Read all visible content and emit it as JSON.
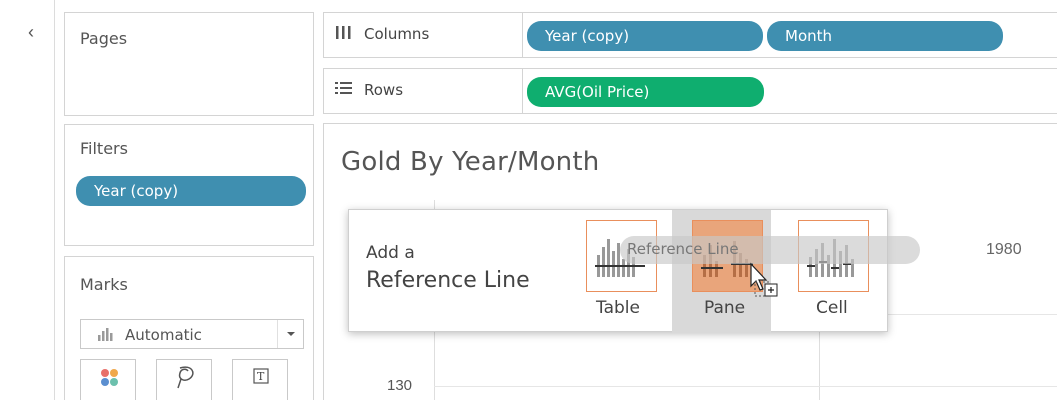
{
  "sidebar": {
    "collapse_glyph": "‹",
    "pages": {
      "title": "Pages"
    },
    "filters": {
      "title": "Filters",
      "pills": [
        {
          "label": "Year (copy)"
        }
      ]
    },
    "marks": {
      "title": "Marks",
      "mark_type": "Automatic",
      "buttons": [
        {
          "name": "color",
          "icon": "color-dots-icon"
        },
        {
          "name": "size",
          "icon": "lasso-icon"
        },
        {
          "name": "label",
          "icon": "text-t-icon",
          "glyph": "T"
        }
      ]
    }
  },
  "shelves": {
    "columns": {
      "label": "Columns",
      "icon": "columns-icon",
      "pills": [
        {
          "label": "Year (copy)"
        },
        {
          "label": "Month"
        }
      ]
    },
    "rows": {
      "label": "Rows",
      "icon": "rows-icon",
      "pills": [
        {
          "label": "AVG(Oil Price)"
        }
      ]
    }
  },
  "view": {
    "title": "Gold  By Year/Month",
    "axis_tick": "130",
    "column_header": "1980"
  },
  "popup": {
    "heading_small": "Add a",
    "heading_large": "Reference Line",
    "options": [
      {
        "label": "Table",
        "icon": "reference-table-icon",
        "highlighted": false
      },
      {
        "label": "Pane",
        "icon": "reference-pane-icon",
        "highlighted": true
      },
      {
        "label": "Cell",
        "icon": "reference-cell-icon",
        "highlighted": false
      }
    ],
    "drag_label": "Reference Line"
  },
  "colors": {
    "pill_blue": "#3f8fb0",
    "pill_green": "#0fae6f",
    "option_border": "#e98f5c",
    "option_highlight": "#e9a57b"
  }
}
